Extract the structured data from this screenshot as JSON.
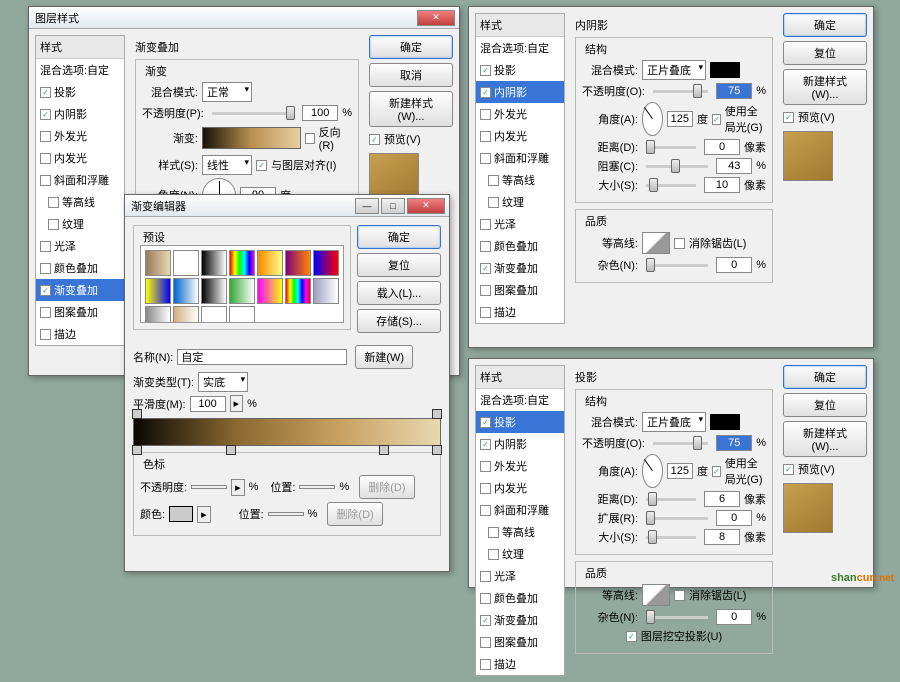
{
  "win1": {
    "title": "图层样式",
    "styles_hdr": "样式",
    "blend_hdr": "混合选项:自定",
    "items": [
      {
        "label": "投影",
        "checked": true
      },
      {
        "label": "内阴影",
        "checked": true
      },
      {
        "label": "外发光",
        "checked": false
      },
      {
        "label": "内发光",
        "checked": false
      },
      {
        "label": "斜面和浮雕",
        "checked": false
      },
      {
        "label": "等高线",
        "checked": false,
        "sub": true
      },
      {
        "label": "纹理",
        "checked": false,
        "sub": true
      },
      {
        "label": "光泽",
        "checked": false
      },
      {
        "label": "颜色叠加",
        "checked": false
      },
      {
        "label": "渐变叠加",
        "checked": true,
        "selected": true
      },
      {
        "label": "图案叠加",
        "checked": false
      },
      {
        "label": "描边",
        "checked": false
      }
    ],
    "section": "渐变叠加",
    "sub": "渐变",
    "blend_label": "混合模式:",
    "blend_val": "正常",
    "opacity_label": "不透明度(P):",
    "opacity_val": "100",
    "pct": "%",
    "grad_label": "渐变:",
    "reverse": "反向(R)",
    "style_label": "样式(S):",
    "style_val": "线性",
    "align": "与图层对齐(I)",
    "angle_label": "角度(N):",
    "angle_val": "90",
    "deg": "度",
    "ok": "确定",
    "cancel": "取消",
    "newstyle": "新建样式(W)...",
    "preview": "预览(V)"
  },
  "ged": {
    "title": "渐变编辑器",
    "presets": "预设",
    "ok": "确定",
    "reset": "复位",
    "load": "载入(L)...",
    "save": "存储(S)...",
    "name_label": "名称(N):",
    "name_val": "自定",
    "new": "新建(W)",
    "gtype_label": "渐变类型(T):",
    "gtype_val": "实底",
    "smooth_label": "平滑度(M):",
    "smooth_val": "100",
    "pct": "%",
    "stops": "色标",
    "op_label": "不透明度:",
    "pos_label": "位置:",
    "del": "删除(D)",
    "color_label": "颜色:",
    "gradients": [
      "#9a7a5a,#e8d8b0",
      "#fff,#fff",
      "#000,#fff",
      "#f00,#ff0,#0f0,#0ff,#00f,#f0f",
      "#f80,#ff8",
      "#800080,#f80",
      "#00f,#f00",
      "#ff0,#00f",
      "#06c,#fff",
      "#000,#fff",
      "#3a3,#fff",
      "#f0f,#ff0",
      "#f00,#ff0,#0f0,#0ff,#00f,#f0f,#f00",
      "#a0a0c0,#fff",
      "#888,#fff",
      "#d0b080,#fff",
      "#fff,#fff",
      "#fff,#fff"
    ]
  },
  "win2": {
    "section": "内阴影",
    "struct": "结构",
    "blend_label": "混合模式:",
    "blend_val": "正片叠底",
    "opacity_label": "不透明度(O):",
    "opacity_val": "75",
    "angle_label": "角度(A):",
    "angle_val": "125",
    "deg": "度",
    "glob": "使用全局光(G)",
    "dist_label": "距离(D):",
    "dist_val": "0",
    "px": "像素",
    "choke_label": "阻塞(C):",
    "choke_val": "43",
    "pct": "%",
    "size_label": "大小(S):",
    "size_val": "10",
    "quality": "品质",
    "contour_label": "等高线:",
    "aa": "消除锯齿(L)",
    "noise_label": "杂色(N):",
    "noise_val": "0",
    "sel": "内阴影"
  },
  "win3": {
    "section": "投影",
    "struct": "结构",
    "blend_label": "混合模式:",
    "blend_val": "正片叠底",
    "opacity_label": "不透明度(O):",
    "opacity_val": "75",
    "angle_label": "角度(A):",
    "angle_val": "125",
    "deg": "度",
    "glob": "使用全局光(G)",
    "dist_label": "距离(D):",
    "dist_val": "6",
    "px": "像素",
    "spread_label": "扩展(R):",
    "spread_val": "0",
    "pct": "%",
    "size_label": "大小(S):",
    "size_val": "8",
    "quality": "品质",
    "contour_label": "等高线:",
    "aa": "消除锯齿(L)",
    "noise_label": "杂色(N):",
    "noise_val": "0",
    "knock": "图层挖空投影(U)",
    "sel": "投影"
  },
  "common": {
    "styles_hdr": "样式",
    "blend_hdr": "混合选项:自定",
    "ok": "确定",
    "reset": "复位",
    "newstyle": "新建样式(W)...",
    "preview": "预览(V)",
    "items": [
      "投影",
      "内阴影",
      "外发光",
      "内发光",
      "斜面和浮雕",
      "等高线",
      "纹理",
      "光泽",
      "颜色叠加",
      "渐变叠加",
      "图案叠加",
      "描边"
    ]
  },
  "logo": {
    "t1": "shan",
    "t2": "cun",
    "t3": ".net"
  }
}
